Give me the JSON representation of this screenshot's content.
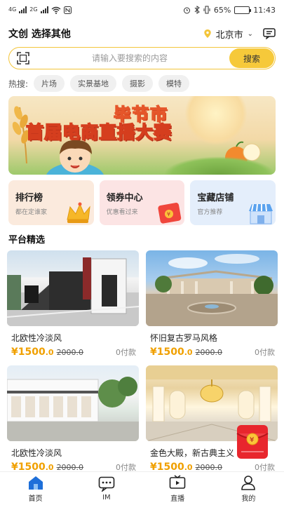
{
  "status": {
    "network": "4G",
    "network2": "2G",
    "battery": "65%",
    "battery_level": 0.65,
    "time": "11:43"
  },
  "header": {
    "title": "文创 选择其他",
    "city": "北京市"
  },
  "search": {
    "placeholder": "请输入要搜索的内容",
    "button": "搜索"
  },
  "hot": {
    "label": "热搜:",
    "tags": [
      "片场",
      "实景基地",
      "摄影",
      "模特"
    ]
  },
  "banner": {
    "line1": "毕节市",
    "line2": "首届电商直播大赛"
  },
  "features": [
    {
      "title": "排行榜",
      "subtitle": "都在定谁家"
    },
    {
      "title": "领券中心",
      "subtitle": "优惠看过来"
    },
    {
      "title": "宝藏店铺",
      "subtitle": "官方推荐"
    }
  ],
  "section": {
    "title": "平台精选"
  },
  "products": [
    {
      "name": "北欧性冷淡风",
      "price": "¥1500",
      "price_decimal": ".0",
      "old_price": "2000.0",
      "paid": "0付款"
    },
    {
      "name": "怀旧复古罗马风格",
      "price": "¥1500",
      "price_decimal": ".0",
      "old_price": "2000.0",
      "paid": "0付款"
    },
    {
      "name": "北欧性冷淡风",
      "price": "¥1500",
      "price_decimal": ".0",
      "old_price": "2000.0",
      "paid": "0付款"
    },
    {
      "name": "金色大殿，新古典主义",
      "price": "¥1500",
      "price_decimal": ".0",
      "old_price": "2000.0",
      "paid": "0付款"
    }
  ],
  "tabs": [
    {
      "label": "首页",
      "icon": "home-icon",
      "active": true
    },
    {
      "label": "IM",
      "icon": "chat-icon"
    },
    {
      "label": "直播",
      "icon": "tv-icon"
    },
    {
      "label": "我的",
      "icon": "user-icon"
    }
  ],
  "colors": {
    "accent": "#f6c93a",
    "price": "#f0a000",
    "active_tab": "#1e6fd9"
  }
}
